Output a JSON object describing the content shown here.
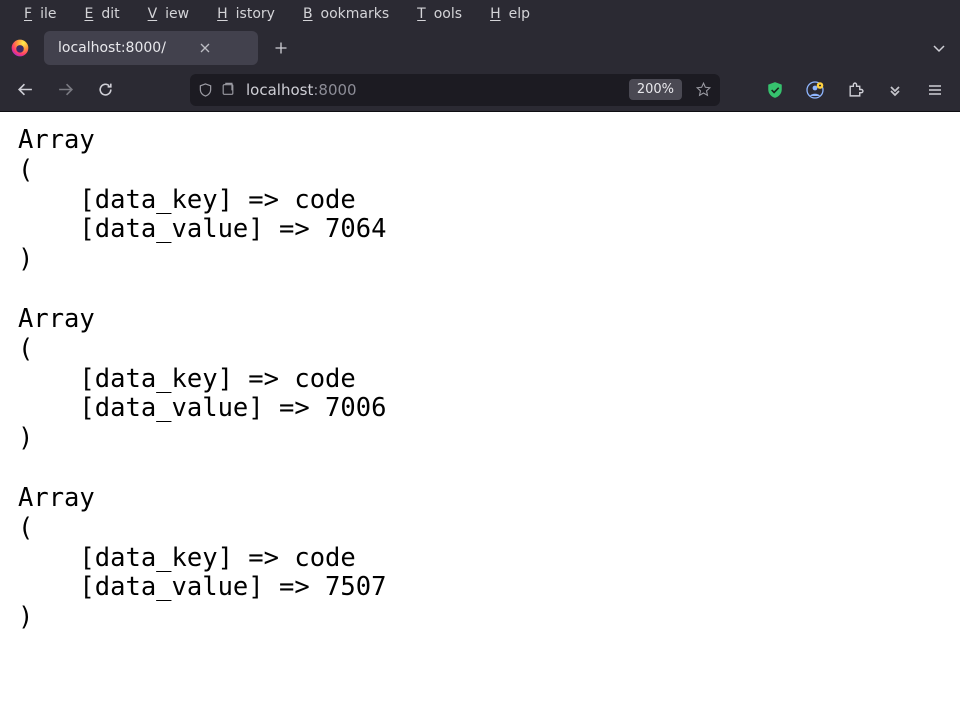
{
  "menu": {
    "file": "File",
    "edit": "Edit",
    "view": "View",
    "history": "History",
    "bookmarks": "Bookmarks",
    "tools": "Tools",
    "help": "Help"
  },
  "tab": {
    "title": "localhost:8000/"
  },
  "urlbar": {
    "host": "localhost",
    "port": ":8000",
    "zoom": "200%"
  },
  "page": {
    "arrays": [
      {
        "data_key": "code",
        "data_value": "7064"
      },
      {
        "data_key": "code",
        "data_value": "7006"
      },
      {
        "data_key": "code",
        "data_value": "7507"
      }
    ]
  }
}
